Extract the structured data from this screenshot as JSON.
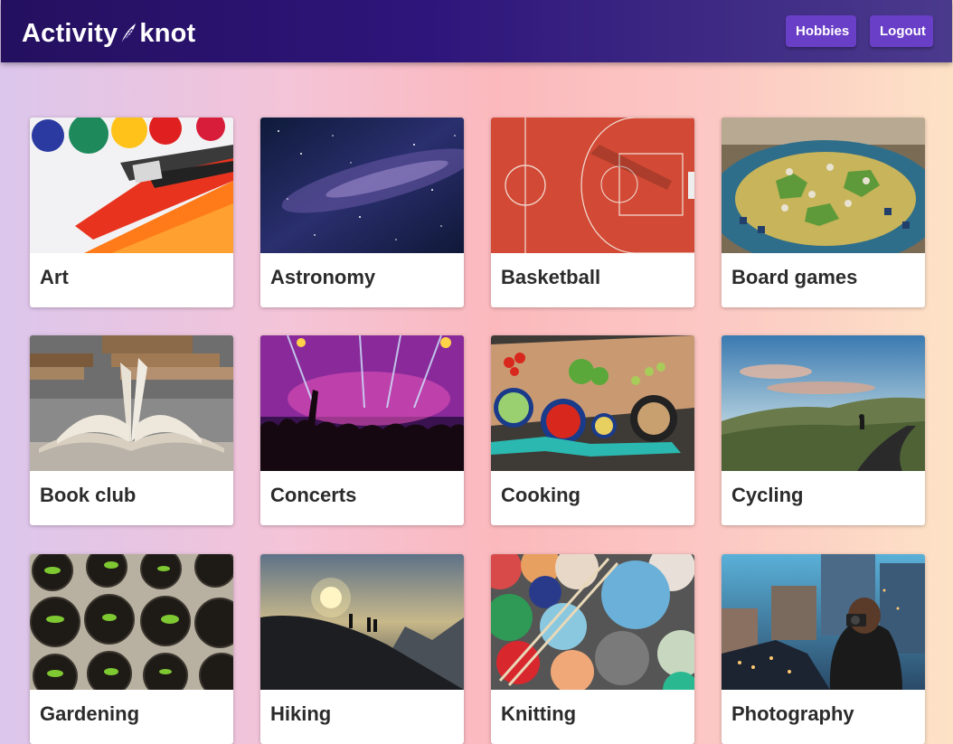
{
  "app": {
    "logo_left": "Activity",
    "logo_right": "knot",
    "logo_icon": "feather-icon"
  },
  "nav": {
    "hobbies_label": "Hobbies",
    "logout_label": "Logout"
  },
  "hobbies": [
    {
      "label": "Art",
      "image": "paintbrush-image"
    },
    {
      "label": "Astronomy",
      "image": "night-sky-image"
    },
    {
      "label": "Basketball",
      "image": "basketball-court-image"
    },
    {
      "label": "Board games",
      "image": "board-game-image"
    },
    {
      "label": "Book club",
      "image": "open-book-image"
    },
    {
      "label": "Concerts",
      "image": "concert-crowd-image"
    },
    {
      "label": "Cooking",
      "image": "cooking-table-image"
    },
    {
      "label": "Cycling",
      "image": "cycling-road-image"
    },
    {
      "label": "Gardening",
      "image": "seedling-pots-image"
    },
    {
      "label": "Hiking",
      "image": "mountain-sunset-image"
    },
    {
      "label": "Knitting",
      "image": "yarn-balls-image"
    },
    {
      "label": "Photography",
      "image": "photographer-image"
    }
  ]
}
